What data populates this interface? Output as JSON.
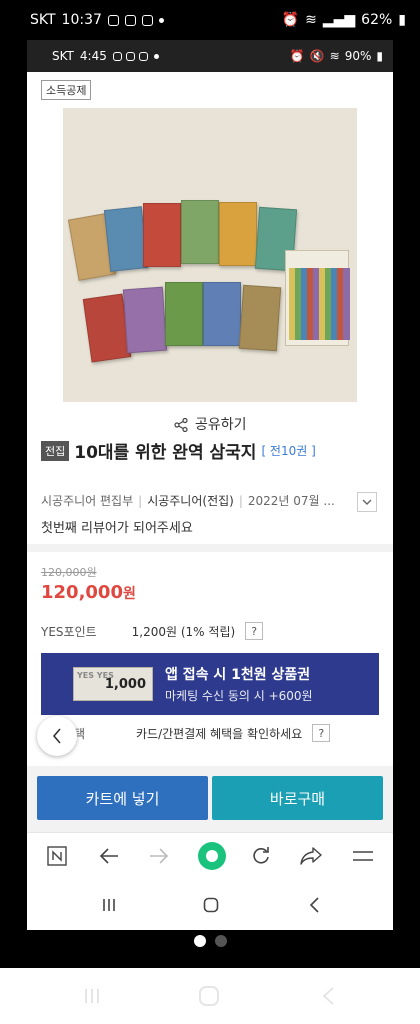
{
  "outer_status": {
    "carrier": "SKT",
    "time": "10:37",
    "battery": "62%"
  },
  "inner_status": {
    "carrier": "SKT",
    "time": "4:45",
    "battery": "90%"
  },
  "badge": "소득공제",
  "share_label": "공유하기",
  "product": {
    "type_pill": "전집",
    "title": "10대를 위한 완역 삼국지",
    "volumes": "[ 전10권 ]",
    "author": "시공주니어 편집부",
    "publisher": "시공주니어(전집)",
    "date": "2022년 07월 ...",
    "review_prompt": "첫번째 리뷰어가 되어주세요"
  },
  "price": {
    "original": "120,000원",
    "sale": "120,000",
    "unit": "원"
  },
  "points": {
    "label": "YES포인트",
    "value": "1,200원 (1% 적립)",
    "help": "?"
  },
  "banner": {
    "coupon_value": "1,000",
    "coupon_brand": "YES YES",
    "line1": "앱 접속 시 1천원 상품권",
    "line2": "마케팅 수신 동의 시 +600원"
  },
  "benefit": {
    "label": "혜택",
    "text": "카드/간편결제 혜택을 확인하세요",
    "help": "?"
  },
  "buttons": {
    "cart": "카트에 넣기",
    "buy": "바로구매"
  },
  "colors": {
    "price_red": "#e0473f",
    "cart_blue": "#2e6fbe",
    "buy_teal": "#1a9fb5",
    "banner_navy": "#2d3a8e",
    "browser_green": "#19c37d"
  }
}
